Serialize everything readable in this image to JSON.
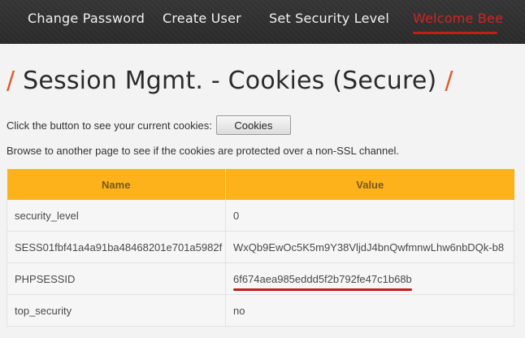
{
  "nav": {
    "items": [
      "Change Password",
      "Create User",
      "Set Security Level",
      "Welcome Bee"
    ]
  },
  "page": {
    "title": "Session Mgmt. - Cookies (Secure)",
    "title_slash": "/",
    "instruction": "Click the button to see your current cookies:",
    "button_label": "Cookies",
    "browse_note": "Browse to another page to see if the cookies are protected over a non-SSL channel."
  },
  "table": {
    "headers": [
      "Name",
      "Value"
    ],
    "rows": [
      {
        "name": "security_level",
        "value": "0"
      },
      {
        "name": "SESS01fbf41a4a91ba48468201e701a5982f",
        "value": "WxQb9EwOc5K5m9Y38VljdJ4bnQwfmnwLhw6nbDQk-b8"
      },
      {
        "name": "PHPSESSID",
        "value": "6f674aea985eddd5f2b792fe47c1b68b"
      },
      {
        "name": "top_security",
        "value": "no"
      }
    ]
  },
  "colors": {
    "nav_bg": "#2f2f2f",
    "accent_red": "#c51c1c",
    "title_slash": "#e0592a",
    "table_header": "#fdb21c"
  }
}
